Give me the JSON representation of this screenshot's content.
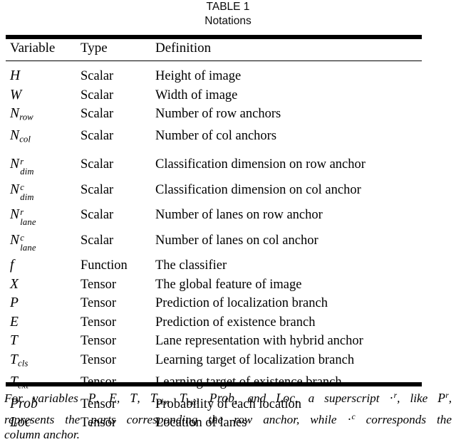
{
  "caption": {
    "label": "TABLE 1",
    "title": "Notations"
  },
  "table": {
    "columns": [
      "Variable",
      "Type",
      "Definition"
    ],
    "rows": [
      {
        "variable": "H",
        "var_base": "H",
        "var_sub": "",
        "var_sup": "",
        "type": "Scalar",
        "definition": "Height of image"
      },
      {
        "variable": "W",
        "var_base": "W",
        "var_sub": "",
        "var_sup": "",
        "type": "Scalar",
        "definition": "Width of image"
      },
      {
        "variable": "N_row",
        "var_base": "N",
        "var_sub": "row",
        "var_sup": "",
        "type": "Scalar",
        "definition": "Number of row anchors"
      },
      {
        "variable": "N_col",
        "var_base": "N",
        "var_sub": "col",
        "var_sup": "",
        "type": "Scalar",
        "definition": "Number of col anchors"
      },
      {
        "variable": "N^r_dim",
        "var_base": "N",
        "var_sub": "dim",
        "var_sup": "r",
        "type": "Scalar",
        "definition": "Classification dimension on row anchor"
      },
      {
        "variable": "N^c_dim",
        "var_base": "N",
        "var_sub": "dim",
        "var_sup": "c",
        "type": "Scalar",
        "definition": "Classification dimension on col anchor"
      },
      {
        "variable": "N^r_lane",
        "var_base": "N",
        "var_sub": "lane",
        "var_sup": "r",
        "type": "Scalar",
        "definition": "Number of lanes on row anchor"
      },
      {
        "variable": "N^c_lane",
        "var_base": "N",
        "var_sub": "lane",
        "var_sup": "c",
        "type": "Scalar",
        "definition": "Number of lanes on col anchor"
      },
      {
        "variable": "f",
        "var_base": "f",
        "var_sub": "",
        "var_sup": "",
        "type": "Function",
        "definition": "The classifier"
      },
      {
        "variable": "X",
        "var_base": "X",
        "var_sub": "",
        "var_sup": "",
        "type": "Tensor",
        "definition": "The global feature of image"
      },
      {
        "variable": "P",
        "var_base": "P",
        "var_sub": "",
        "var_sup": "",
        "type": "Tensor",
        "definition": "Prediction of localization branch"
      },
      {
        "variable": "E",
        "var_base": "E",
        "var_sub": "",
        "var_sup": "",
        "type": "Tensor",
        "definition": "Prediction of existence branch"
      },
      {
        "variable": "T",
        "var_base": "T",
        "var_sub": "",
        "var_sup": "",
        "type": "Tensor",
        "definition": "Lane representation with hybrid anchor"
      },
      {
        "variable": "T_cls",
        "var_base": "T",
        "var_sub": "cls",
        "var_sup": "",
        "type": "Tensor",
        "definition": "Learning target of localization branch"
      },
      {
        "variable": "T_ext",
        "var_base": "T",
        "var_sub": "ext",
        "var_sup": "",
        "type": "Tensor",
        "definition": "Learning target of existence branch"
      },
      {
        "variable": "Prob",
        "var_base": "Prob",
        "var_sub": "",
        "var_sup": "",
        "type": "Tensor",
        "definition": "Probability of each location"
      },
      {
        "variable": "Loc",
        "var_base": "Loc",
        "var_sub": "",
        "var_sup": "",
        "type": "Tensor",
        "definition": "Location of lanes"
      }
    ]
  },
  "footnote": {
    "l1_a": "For variables ",
    "l1_P": "P",
    "l1_s1": ", ",
    "l1_E": "E",
    "l1_s2": ", ",
    "l1_T": "T",
    "l1_s3": ", ",
    "l1_Tcls_base": "T",
    "l1_Tcls_sub": "cls",
    "l1_s4": ", ",
    "l1_Text_base": "T",
    "l1_Text_sub": "ext",
    "l1_s5": ", ",
    "l1_Prob": "Prob",
    "l1_s6": ", and ",
    "l1_Loc": "Loc",
    "l1_b": ", a superscript ",
    "l1_dot_r_dot": "·",
    "l1_dot_r_sup": "r",
    "l1_c": ", like ",
    "l1_Pr_base": "P",
    "l1_Pr_sup": "r",
    "l1_d": ",",
    "l2_a": "represents the parts corresponding the row anchor, while ",
    "l2_dot_c_dot": "·",
    "l2_dot_c_sup": "c",
    "l2_b": " corresponds the",
    "l3": "column anchor."
  },
  "colors": {
    "background": "#ffffff",
    "text": "#000000",
    "rule": "#000000"
  }
}
